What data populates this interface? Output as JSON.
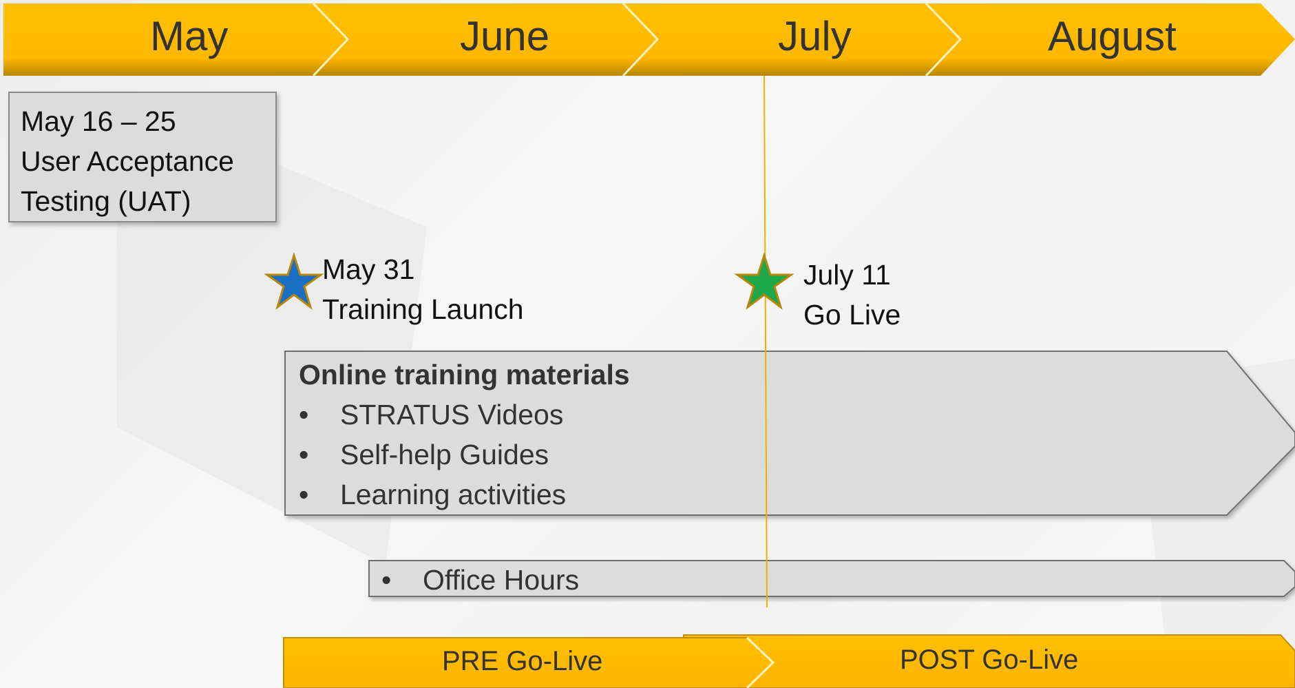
{
  "months": [
    "May",
    "June",
    "July",
    "August"
  ],
  "uat": {
    "date": "May 16 – 25",
    "line1": "User Acceptance",
    "line2": "Testing (UAT)"
  },
  "milestones": {
    "training": {
      "date": "May 31",
      "label": "Training Launch",
      "icon": "star-icon",
      "color": "#1a6fc4"
    },
    "golive": {
      "date": "July 11",
      "label": "Go Live",
      "icon": "star-icon",
      "color": "#1fa84a"
    }
  },
  "online_training": {
    "title": "Online training materials",
    "bullet": "•",
    "items": [
      "STRATUS Videos",
      "Self-help Guides",
      "Learning activities"
    ]
  },
  "office_hours": {
    "bullet": "•",
    "label": "Office Hours"
  },
  "phases": {
    "pre": "PRE Go-Live",
    "post": "POST Go-Live"
  },
  "colors": {
    "accent": "#ffb800",
    "accent_dark": "#9c7400",
    "panel": "#dcdcdc",
    "divider": "#f0b000"
  }
}
